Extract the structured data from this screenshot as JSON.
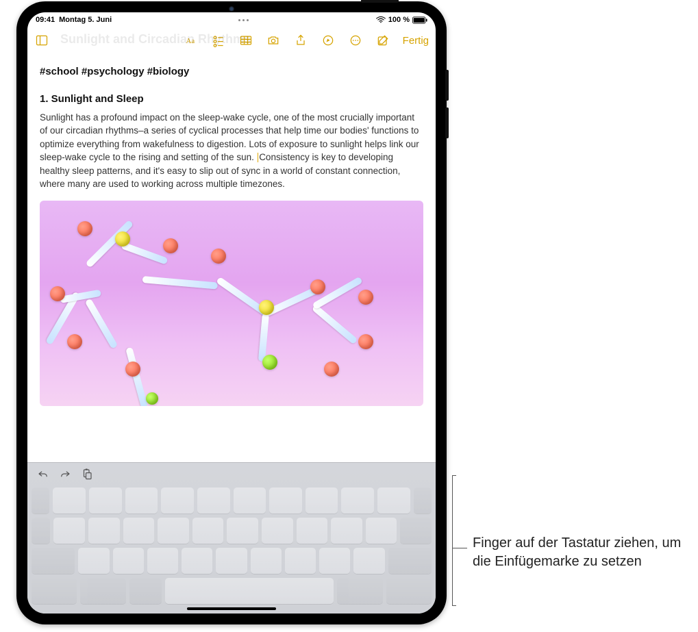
{
  "status": {
    "time": "09:41",
    "date": "Montag 5. Juni",
    "battery_pct": "100 %"
  },
  "toolbar": {
    "ghost_title": "Sunlight and Circadian Rhythms",
    "done_label": "Fertig",
    "icons": {
      "sidebar": "sidebar-icon",
      "format": "format-icon",
      "checklist": "checklist-icon",
      "table": "table-icon",
      "camera": "camera-icon",
      "share": "share-icon",
      "markup": "markup-icon",
      "more": "more-icon",
      "compose": "compose-icon"
    }
  },
  "note": {
    "tags_line": "#school #psychology #biology",
    "heading": "1. Sunlight and Sleep",
    "paragraph": "Sunlight has a profound impact on the sleep-wake cycle, one of the most crucially important of our circadian rhythms–a series of cyclical processes that help time our bodies' functions to optimize everything from wakefulness to digestion. Lots of exposure to sunlight helps link our sleep-wake cycle to the rising and setting of the sun. Consistency is key to developing healthy sleep patterns, and it's easy to slip out of sync in a world of constant connection, where many are used to working across multiple timezones."
  },
  "keyboard": {
    "mode": "trackpad-blank",
    "tool_icons": {
      "undo": "undo-icon",
      "redo": "redo-icon",
      "paste": "paste-icon"
    }
  },
  "callout": {
    "text": "Finger auf der Tastatur ziehen, um die Einfügemarke zu setzen"
  }
}
